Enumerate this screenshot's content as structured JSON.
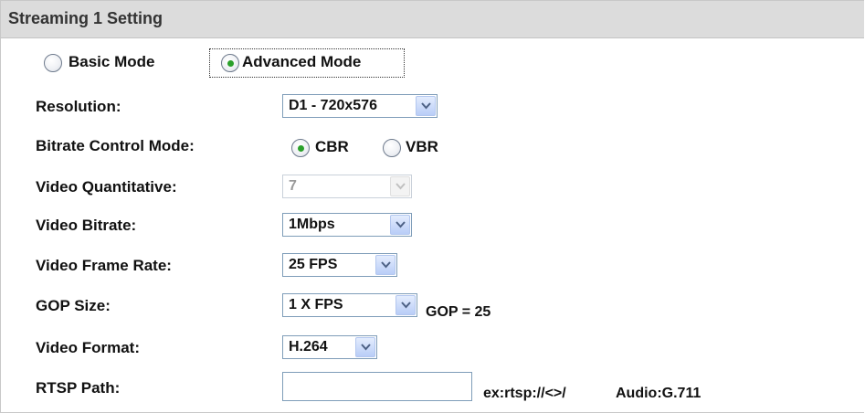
{
  "header": {
    "title": "Streaming 1 Setting"
  },
  "mode": {
    "basic_label": "Basic Mode",
    "advanced_label": "Advanced Mode",
    "selected": "advanced"
  },
  "fields": {
    "resolution": {
      "label": "Resolution:",
      "value": "D1 - 720x576"
    },
    "bitrate_mode": {
      "label": "Bitrate Control Mode:",
      "cbr_label": "CBR",
      "vbr_label": "VBR",
      "selected": "CBR"
    },
    "video_quantitative": {
      "label": "Video Quantitative:",
      "value": "7",
      "disabled": true
    },
    "video_bitrate": {
      "label": "Video Bitrate:",
      "value": "1Mbps"
    },
    "frame_rate": {
      "label": "Video Frame Rate:",
      "value": "25 FPS"
    },
    "gop_size": {
      "label": "GOP Size:",
      "value": "1 X FPS",
      "note": "GOP = 25"
    },
    "video_format": {
      "label": "Video Format:",
      "value": "H.264"
    },
    "rtsp_path": {
      "label": "RTSP Path:",
      "value": "",
      "placeholder": "",
      "hint": "ex:rtsp://<>/",
      "audio": "Audio:G.711"
    }
  },
  "icons": {
    "dropdown": "chevron-down-icon"
  },
  "colors": {
    "header_bg": "#dcdcdc",
    "radio_dot": "#2aa02a",
    "dropdown_btn": "#b9cdf7"
  }
}
